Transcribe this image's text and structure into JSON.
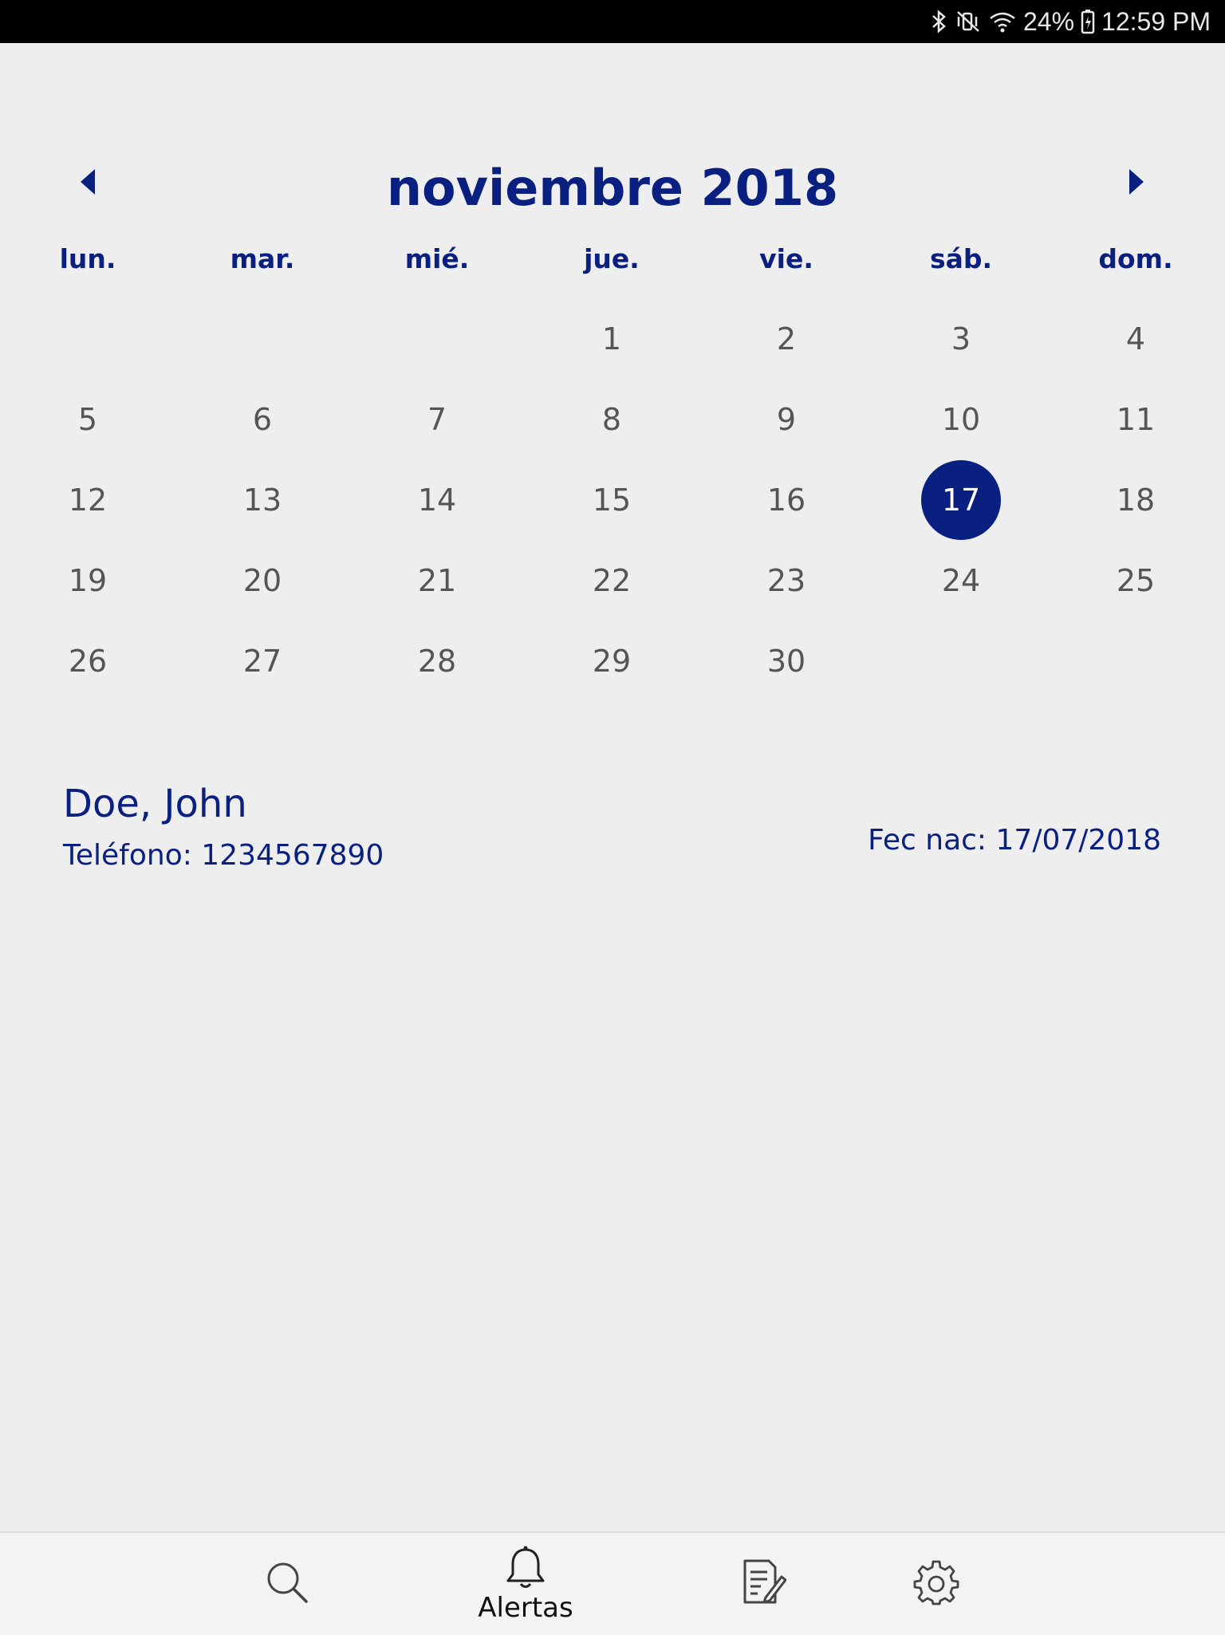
{
  "status_bar": {
    "battery": "24%",
    "time": "12:59 PM",
    "icons": [
      "bluetooth-icon",
      "mute-vibrate-icon",
      "wifi-icon",
      "battery-charging-icon"
    ]
  },
  "calendar": {
    "month_title": "noviembre 2018",
    "weekdays": [
      "lun.",
      "mar.",
      "mié.",
      "jue.",
      "vie.",
      "sáb.",
      "dom."
    ],
    "first_weekday_index": 3,
    "days_in_month": 30,
    "selected_day": 17,
    "day_labels": [
      "1",
      "2",
      "3",
      "4",
      "5",
      "6",
      "7",
      "8",
      "9",
      "10",
      "11",
      "12",
      "13",
      "14",
      "15",
      "16",
      "17",
      "18",
      "19",
      "20",
      "21",
      "22",
      "23",
      "24",
      "25",
      "26",
      "27",
      "28",
      "29",
      "30"
    ],
    "colors": {
      "accent": "#0a2080",
      "day_text": "#555555"
    }
  },
  "patient": {
    "name": "Doe, John",
    "phone": "Teléfono: 1234567890",
    "dob": "Fec nac: 17/07/2018"
  },
  "bottom_nav": {
    "items": [
      {
        "icon": "search-icon",
        "label": ""
      },
      {
        "icon": "bell-icon",
        "label": "Alertas"
      },
      {
        "icon": "edit-document-icon",
        "label": ""
      },
      {
        "icon": "gear-icon",
        "label": ""
      }
    ]
  }
}
